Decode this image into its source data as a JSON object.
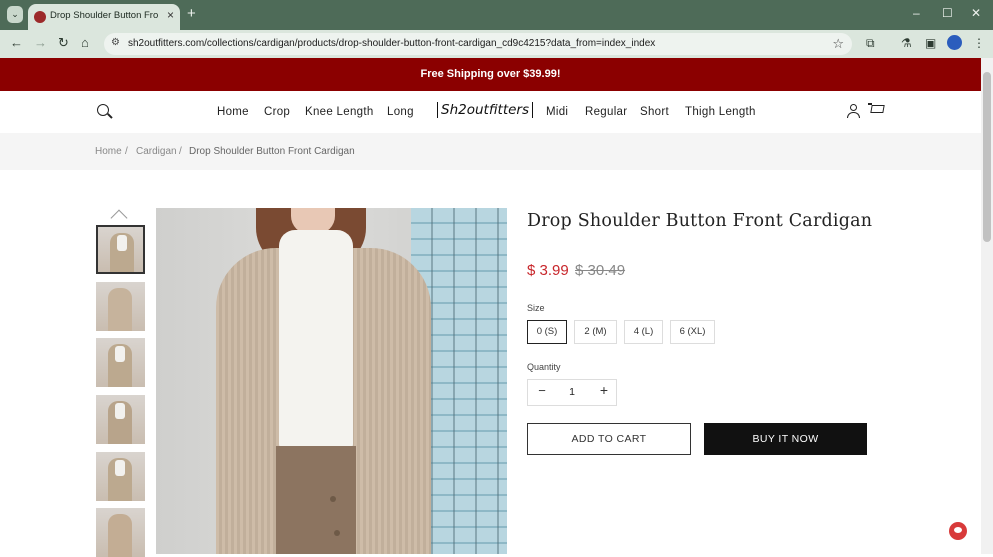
{
  "browser": {
    "tab_title": "Drop Shoulder Button Front Ca",
    "url": "sh2outfitters.com/collections/cardigan/products/drop-shoulder-button-front-cardigan_cd9c4215?data_from=index_index"
  },
  "promo": {
    "text": "Free Shipping over $39.99!"
  },
  "header": {
    "logo": "Sh2outfitters",
    "nav_left": [
      "Home",
      "Crop",
      "Knee Length",
      "Long"
    ],
    "nav_right": [
      "Midi",
      "Regular",
      "Short",
      "Thigh Length"
    ]
  },
  "breadcrumb": {
    "home": "Home",
    "category": "Cardigan",
    "current": "Drop Shoulder Button Front Cardigan",
    "separator": "/"
  },
  "product": {
    "title": "Drop Shoulder Button Front Cardigan",
    "price_sale": "$ 3.99",
    "price_original": "$ 30.49",
    "size_label": "Size",
    "sizes": [
      "0 (S)",
      "2 (M)",
      "4 (L)",
      "6 (XL)"
    ],
    "selected_size": "0 (S)",
    "quantity_label": "Quantity",
    "quantity": "1",
    "add_to_cart": "ADD TO CART",
    "buy_now": "BUY IT NOW"
  },
  "colors": {
    "promo_bg": "#8b0000",
    "sale_price": "#c8262b",
    "buy_btn": "#111111"
  },
  "icons": [
    "search-icon",
    "account-icon",
    "cart-icon",
    "chevron-up-icon",
    "minus-icon",
    "plus-icon",
    "chat-icon"
  ]
}
